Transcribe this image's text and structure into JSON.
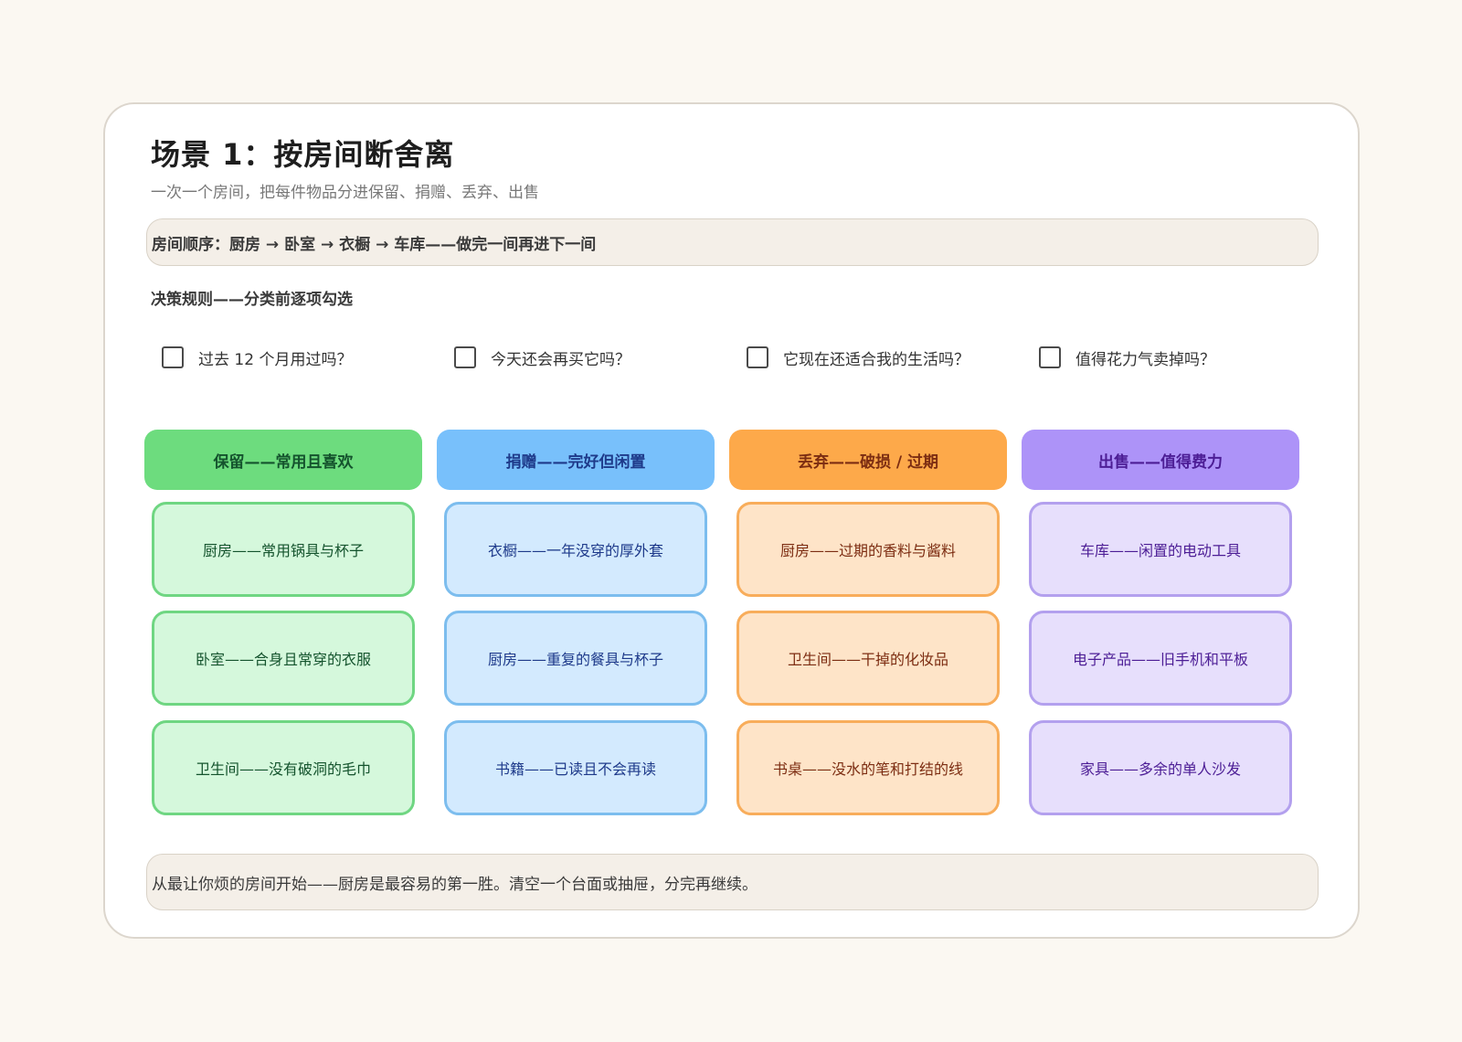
{
  "title": "场景 1：按房间断舍离",
  "subtitle": "一次一个房间，把每件物品分进保留、捐赠、丢弃、出售",
  "room_order": "房间顺序：厨房 → 卧室 → 衣橱 → 车库——做完一间再进下一间",
  "rules_label": "决策规则——分类前逐项勾选",
  "checklist": [
    "过去 12 个月用过吗？",
    "今天还会再买它吗？",
    "它现在还适合我的生活吗？",
    "值得花力气卖掉吗？"
  ],
  "columns": [
    {
      "header": "保留——常用且喜欢",
      "color": "#6ddc7e",
      "items": [
        "厨房——常用锅具与杯子",
        "卧室——合身且常穿的衣服",
        "卫生间——没有破洞的毛巾"
      ]
    },
    {
      "header": "捐赠——完好但闲置",
      "color": "#78c0fb",
      "items": [
        "衣橱——一年没穿的厚外套",
        "厨房——重复的餐具与杯子",
        "书籍——已读且不会再读"
      ]
    },
    {
      "header": "丢弃——破损 / 过期",
      "color": "#fda94a",
      "items": [
        "厨房——过期的香料与酱料",
        "卫生间——干掉的化妆品",
        "书桌——没水的笔和打结的线"
      ]
    },
    {
      "header": "出售——值得费力",
      "color": "#ad93f8",
      "items": [
        "车库——闲置的电动工具",
        "电子产品——旧手机和平板",
        "家具——多余的单人沙发"
      ]
    }
  ],
  "tip": "从最让你烦的房间开始——厨房是最容易的第一胜。清空一个台面或抽屉，分完再继续。"
}
